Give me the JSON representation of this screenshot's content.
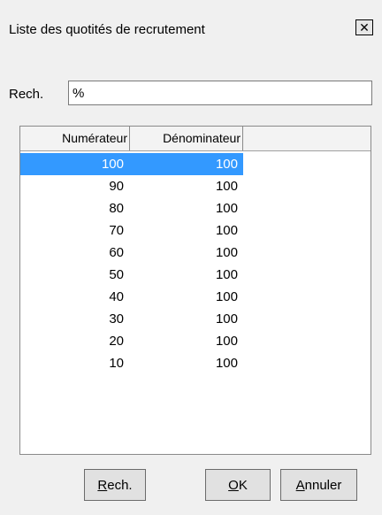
{
  "window": {
    "title": "Liste des quotités de recrutement",
    "close_glyph": "✕"
  },
  "search": {
    "label": "Rech.",
    "value": "%"
  },
  "grid": {
    "columns": [
      "Numérateur",
      "Dénominateur"
    ],
    "rows": [
      {
        "numerateur": "100",
        "denominateur": "100",
        "selected": true
      },
      {
        "numerateur": "90",
        "denominateur": "100"
      },
      {
        "numerateur": "80",
        "denominateur": "100"
      },
      {
        "numerateur": "70",
        "denominateur": "100"
      },
      {
        "numerateur": "60",
        "denominateur": "100"
      },
      {
        "numerateur": "50",
        "denominateur": "100"
      },
      {
        "numerateur": "40",
        "denominateur": "100"
      },
      {
        "numerateur": "30",
        "denominateur": "100"
      },
      {
        "numerateur": "20",
        "denominateur": "100"
      },
      {
        "numerateur": "10",
        "denominateur": "100"
      }
    ],
    "selection_color": "#3399ff"
  },
  "buttons": {
    "rech": {
      "accel": "R",
      "rest": "ech."
    },
    "ok": {
      "accel": "O",
      "rest": "K"
    },
    "cancel": {
      "accel": "A",
      "rest": "nnuler"
    }
  }
}
